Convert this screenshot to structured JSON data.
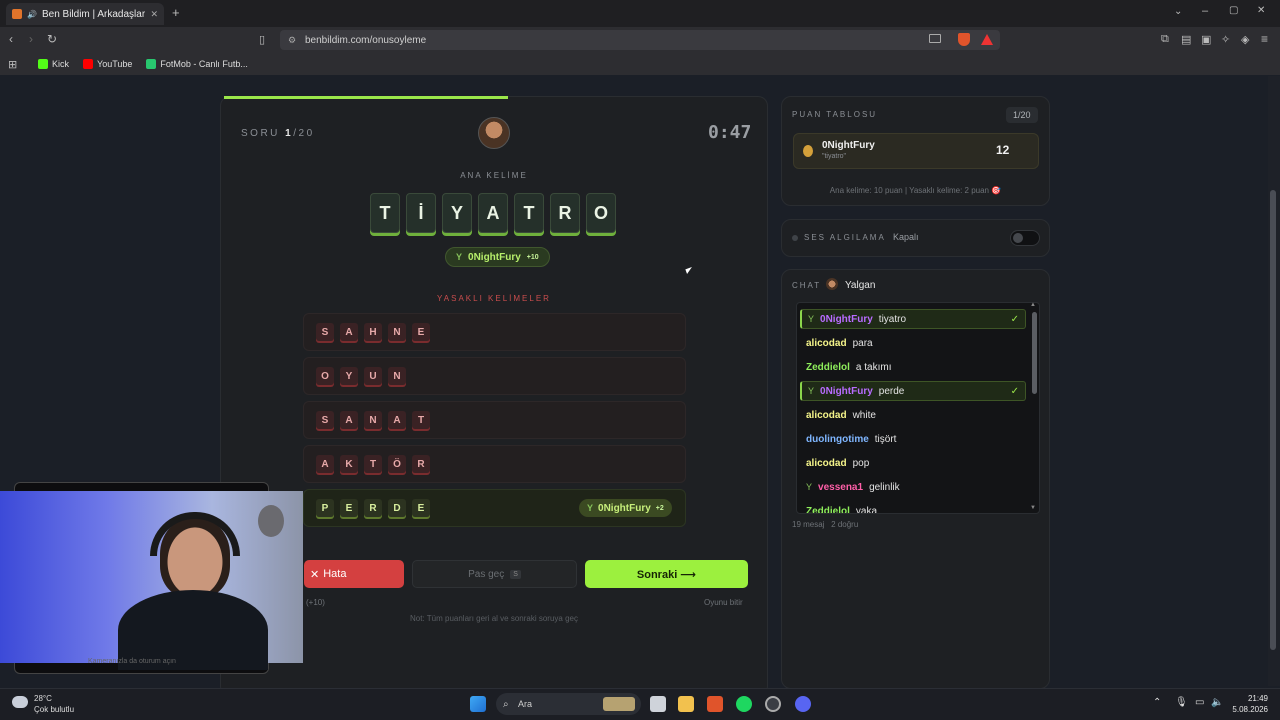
{
  "browser": {
    "tab_title": "Ben Bildim | Arkadaşlarınla O...",
    "tab_close": "✕",
    "new_tab": "+",
    "url": "benbildim.com/onusoyleme",
    "bookmarks": [
      {
        "label": "Kick",
        "color": "#53fc18"
      },
      {
        "label": "YouTube",
        "color": "#ff0000"
      },
      {
        "label": "FotMob - Canlı Futb...",
        "color": "#28c76f"
      }
    ]
  },
  "game": {
    "question_prefix": "SORU ",
    "question_current": "1",
    "question_total": "/20",
    "timer": "0:47",
    "main_word_label": "ANA KELİME",
    "main_word_letters": [
      "T",
      "İ",
      "Y",
      "A",
      "T",
      "R",
      "O"
    ],
    "winner": {
      "name": "0NightFury",
      "points": "+10"
    },
    "forbidden_label": "YASAKLI KELİMELER",
    "forbidden_words": [
      {
        "letters": [
          "S",
          "A",
          "H",
          "N",
          "E"
        ],
        "guessed": false
      },
      {
        "letters": [
          "O",
          "Y",
          "U",
          "N"
        ],
        "guessed": false
      },
      {
        "letters": [
          "S",
          "A",
          "N",
          "A",
          "T"
        ],
        "guessed": false
      },
      {
        "letters": [
          "A",
          "K",
          "T",
          "Ö",
          "R"
        ],
        "guessed": false
      },
      {
        "letters": [
          "P",
          "E",
          "R",
          "D",
          "E"
        ],
        "guessed": true
      }
    ],
    "perde_guesser": {
      "name": "0NightFury",
      "points": "+2"
    },
    "buttons": {
      "error_label": "Hata",
      "error_icon": "✕",
      "error_sub": "(+10)",
      "pass_label": "Pas geç",
      "pass_key": "S",
      "next_label": "Sonraki ⟶",
      "end_label": "Oyunu bitir"
    },
    "note": "Not: Tüm puanları geri al ve sonraki soruya geç"
  },
  "scoreboard": {
    "title": "PUAN TABLOSU",
    "count": "1/20",
    "entries": [
      {
        "name": "0NightFury",
        "word": "\"tiyatro\"",
        "points": "12"
      }
    ],
    "note": "Ana kelime: 10 puan | Yasaklı kelime: 2 puan 🎯"
  },
  "voice": {
    "title": "SES ALGILAMA",
    "state": "Kapalı",
    "enabled": false
  },
  "chat": {
    "title": "CHAT",
    "host": "Yalgan",
    "messages": [
      {
        "user": "0NightFury",
        "text": "tiyatro",
        "color": "#b86cff",
        "correct": true,
        "badge": true
      },
      {
        "user": "alicodad",
        "text": "para",
        "color": "#f5f58a",
        "correct": false,
        "badge": false
      },
      {
        "user": "Zeddielol",
        "text": "a takımı",
        "color": "#8fef5c",
        "correct": false,
        "badge": false
      },
      {
        "user": "0NightFury",
        "text": "perde",
        "color": "#b86cff",
        "correct": true,
        "badge": true
      },
      {
        "user": "alicodad",
        "text": "white",
        "color": "#f5f58a",
        "correct": false,
        "badge": false
      },
      {
        "user": "duolingotime",
        "text": "tişört",
        "color": "#7fb6ff",
        "correct": false,
        "badge": false
      },
      {
        "user": "alicodad",
        "text": "pop",
        "color": "#f5f58a",
        "correct": false,
        "badge": false
      },
      {
        "user": "vessena1",
        "text": "gelinlik",
        "color": "#ff5fa8",
        "correct": false,
        "badge": true
      },
      {
        "user": "Zeddielol",
        "text": "yaka",
        "color": "#8fef5c",
        "correct": false,
        "badge": false
      }
    ],
    "stats_messages": "19 mesaj",
    "stats_correct": "2 doğru"
  },
  "webcam": {
    "caption": "Kameranızla da oturum açın"
  },
  "taskbar": {
    "temp": "28°C",
    "weather": "Çok bulutlu",
    "search": "Ara",
    "time": "21:49",
    "date": "5.08.2026"
  }
}
